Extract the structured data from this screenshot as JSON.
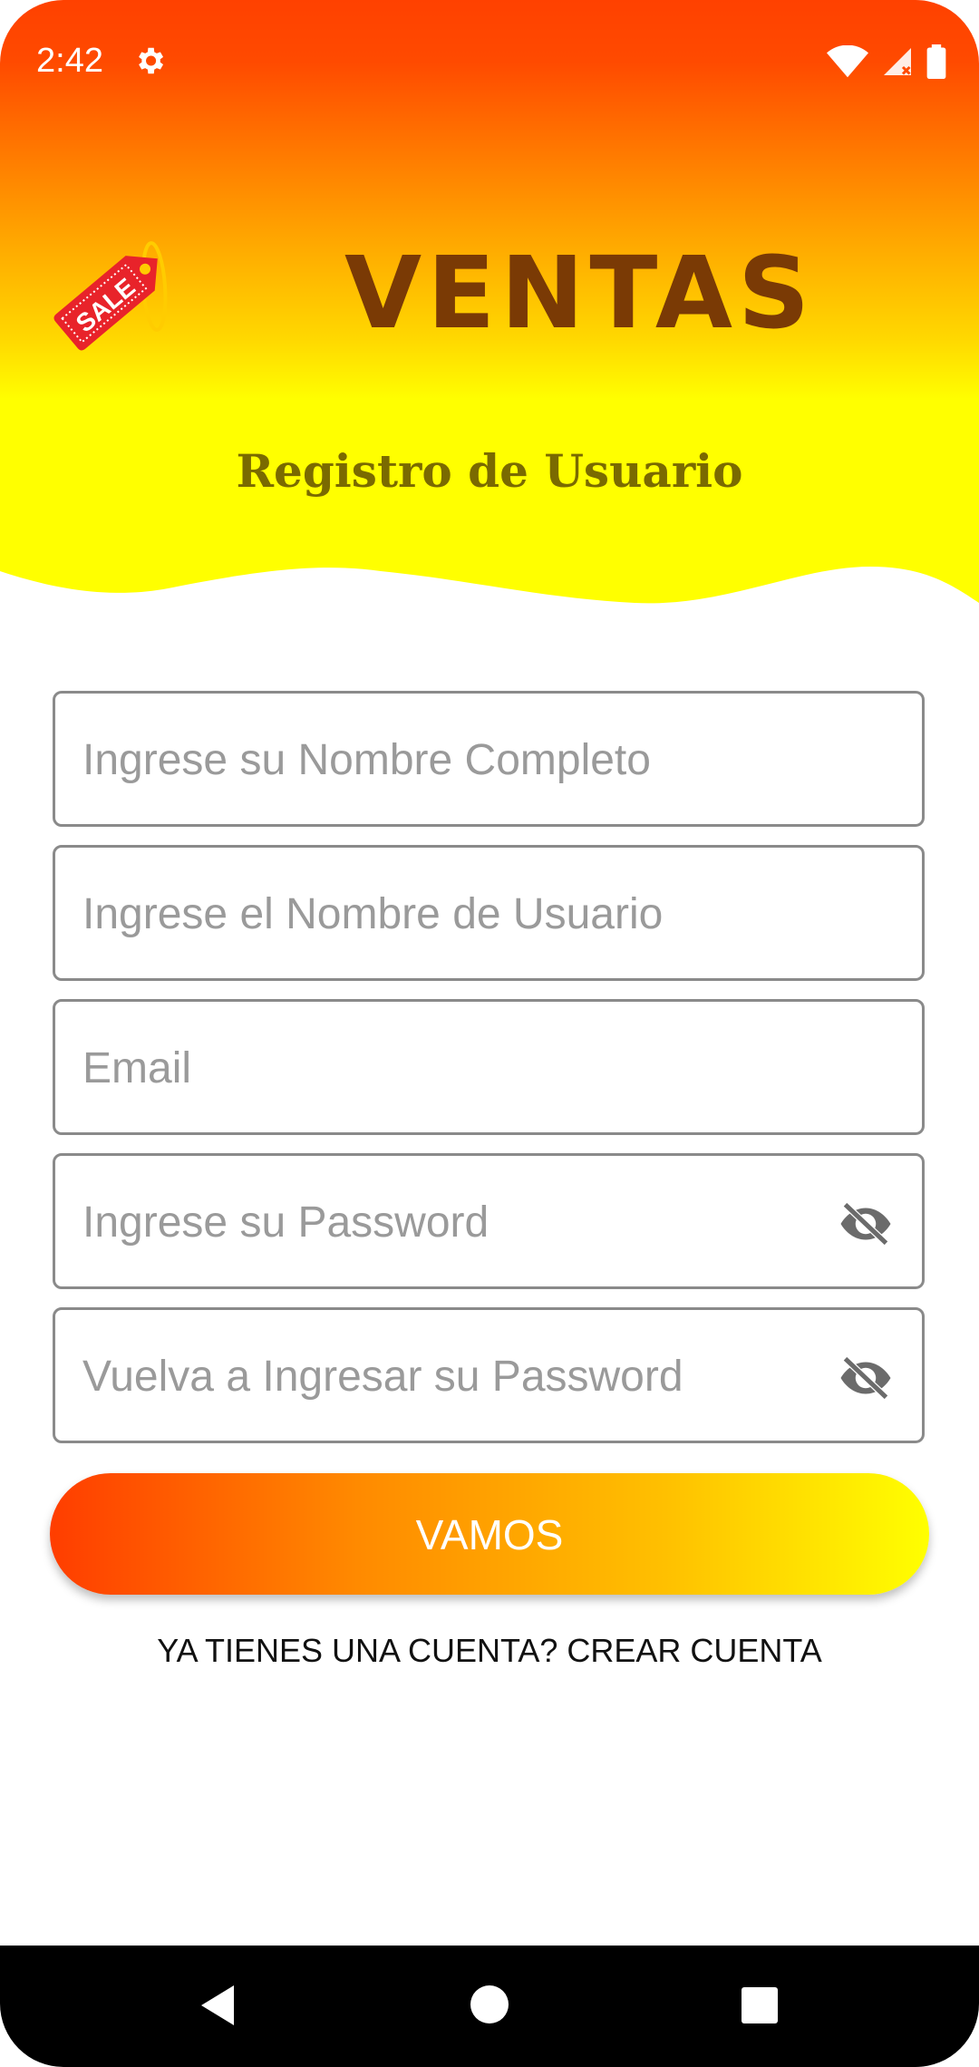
{
  "status_bar": {
    "time": "2:42"
  },
  "header": {
    "app_title": "VENTAS",
    "subtitle": "Registro de Usuario",
    "logo_text": "SALE"
  },
  "form": {
    "full_name_placeholder": "Ingrese su Nombre Completo",
    "username_placeholder": "Ingrese el Nombre de Usuario",
    "email_placeholder": "Email",
    "password_placeholder": "Ingrese su Password",
    "confirm_password_placeholder": "Vuelva a Ingresar su Password",
    "submit_label": "VAMOS",
    "account_link": "YA TIENES UNA CUENTA? CREAR CUENTA"
  },
  "colors": {
    "header_top": "#ff4100",
    "header_bottom": "#ffff00",
    "title": "#7a3a05",
    "subtitle": "#7a6a00"
  }
}
